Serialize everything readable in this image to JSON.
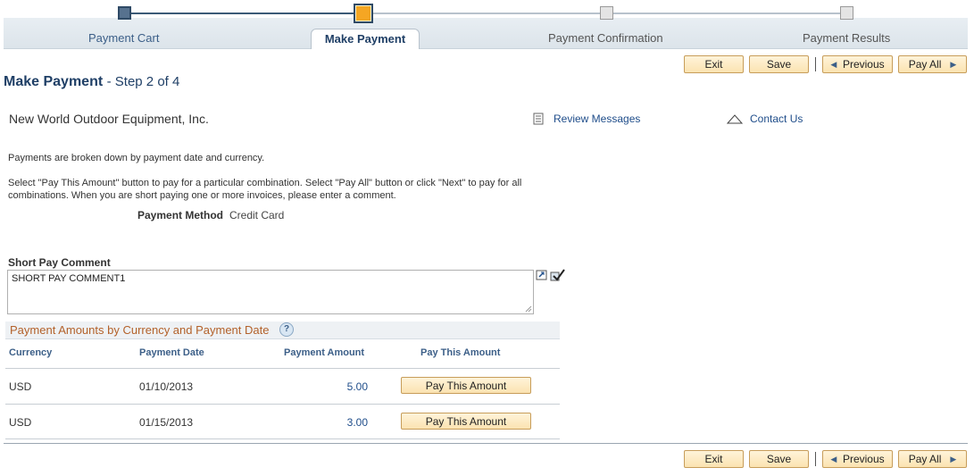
{
  "train": {
    "steps": [
      {
        "label": "Payment Cart"
      },
      {
        "label": "Make Payment"
      },
      {
        "label": "Payment Confirmation"
      },
      {
        "label": "Payment Results"
      }
    ]
  },
  "toolbar": {
    "exit": "Exit",
    "save": "Save",
    "previous": "Previous",
    "pay_all": "Pay All"
  },
  "page": {
    "title": "Make Payment",
    "step": "- Step 2 of 4",
    "company": "New World Outdoor Equipment, Inc.",
    "review_messages": "Review Messages",
    "contact_us": "Contact Us",
    "instructions_1": "Payments are broken down by payment date and currency.",
    "instructions_2": "Select \"Pay This Amount\" button to pay for a particular combination.  Select \"Pay All\" button or click \"Next\" to pay for all combinations.  When you are short paying one or more invoices, please enter a comment.",
    "payment_method_label": "Payment Method",
    "payment_method_value": "Credit Card",
    "short_pay_label": "Short Pay Comment",
    "short_pay_value": "SHORT PAY COMMENT1"
  },
  "grid": {
    "title": "Payment Amounts by Currency and Payment Date",
    "help": "?",
    "columns": [
      "Currency",
      "Payment Date",
      "Payment Amount",
      "Pay This Amount"
    ],
    "rows": [
      {
        "currency": "USD",
        "date": "01/10/2013",
        "amount": "5.00",
        "button": "Pay This Amount"
      },
      {
        "currency": "USD",
        "date": "01/15/2013",
        "amount": "3.00",
        "button": "Pay This Amount"
      }
    ]
  },
  "colors": {
    "accent": "#1f3f66",
    "link": "#1f4d8a",
    "grid_title": "#b3612a",
    "button_bg": "#fbe3b1",
    "active_step": "#f5a623"
  }
}
